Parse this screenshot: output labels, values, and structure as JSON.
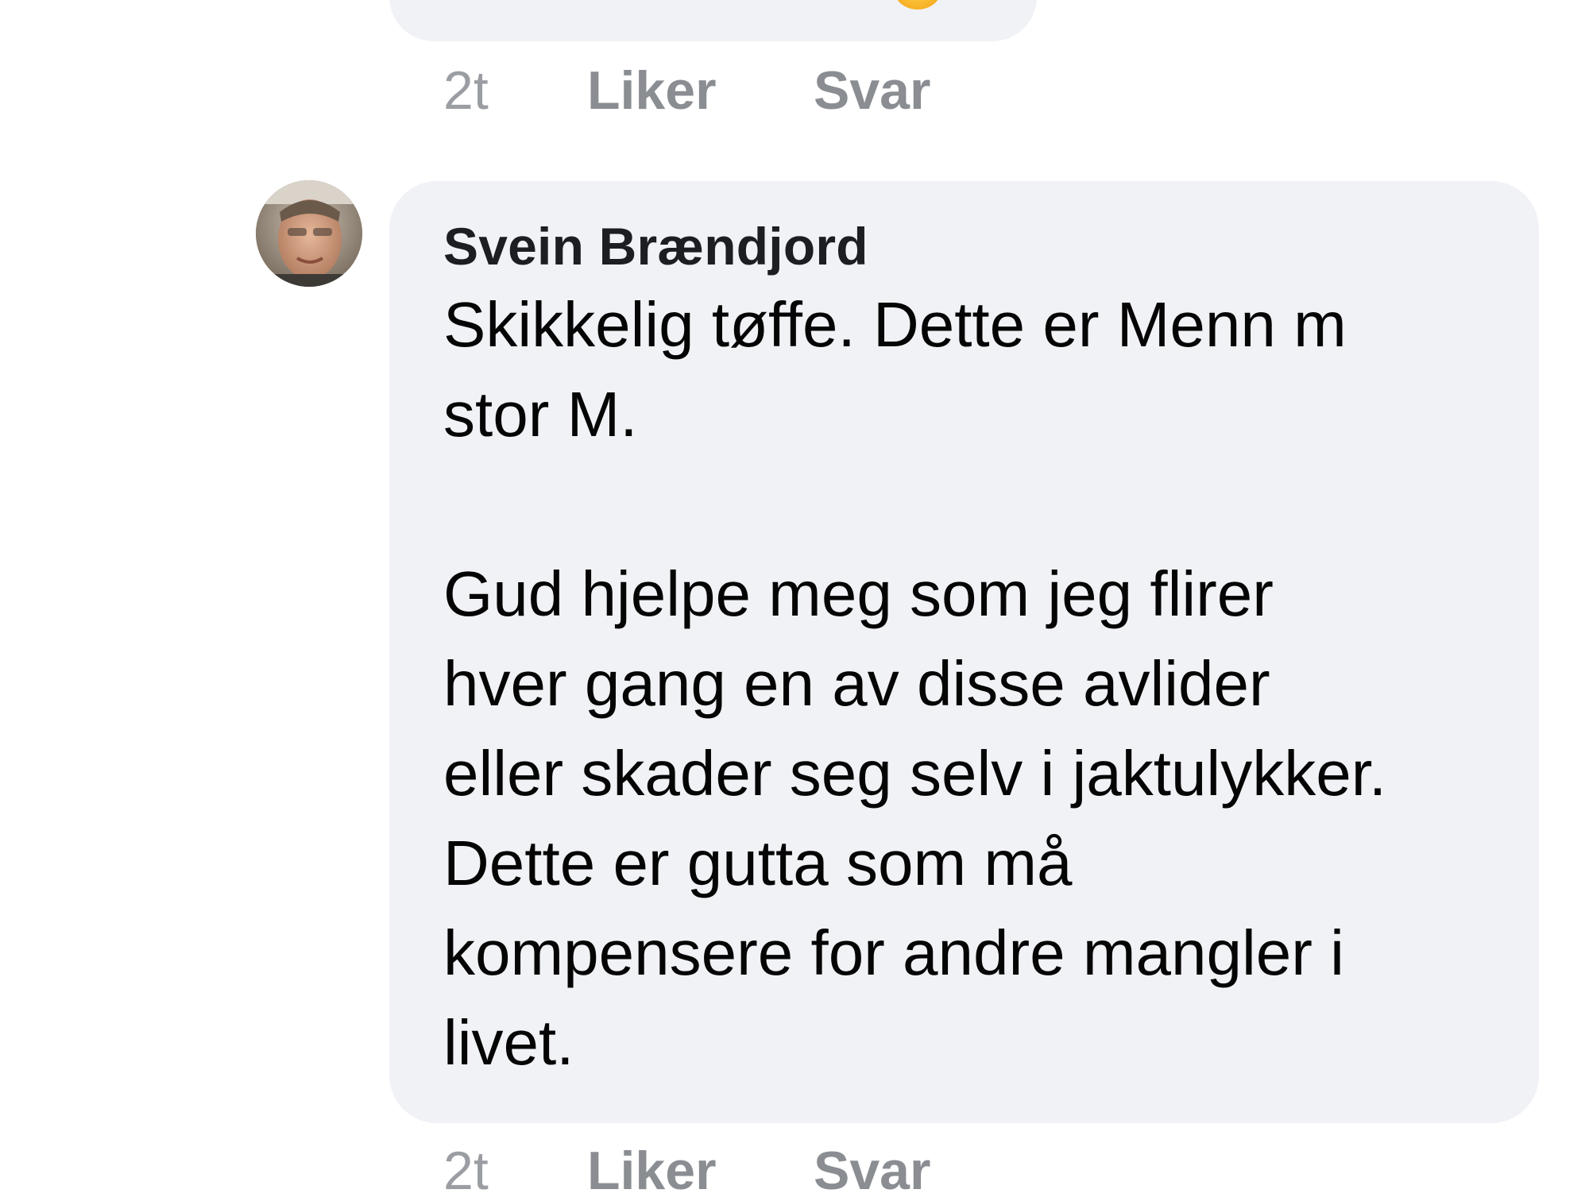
{
  "previous_comment": {
    "time": "2t",
    "like_label": "Liker",
    "reply_label": "Svar"
  },
  "comment": {
    "author": "Svein Brændjord",
    "paragraphs": [
      [
        "Skikkelig tøffe. Dette er Menn m",
        "stor M."
      ],
      [
        "Gud hjelpe meg som jeg flirer",
        "hver gang en av disse avlider",
        "eller skader seg selv i jaktulykker.",
        "Dette er gutta som må",
        "kompensere for andre mangler i",
        "livet."
      ]
    ],
    "time": "2t",
    "like_label": "Liker",
    "reply_label": "Svar"
  },
  "colors": {
    "bubble_background": "#f0f2f5",
    "text": "#050505",
    "action_text": "#8a8d91"
  }
}
